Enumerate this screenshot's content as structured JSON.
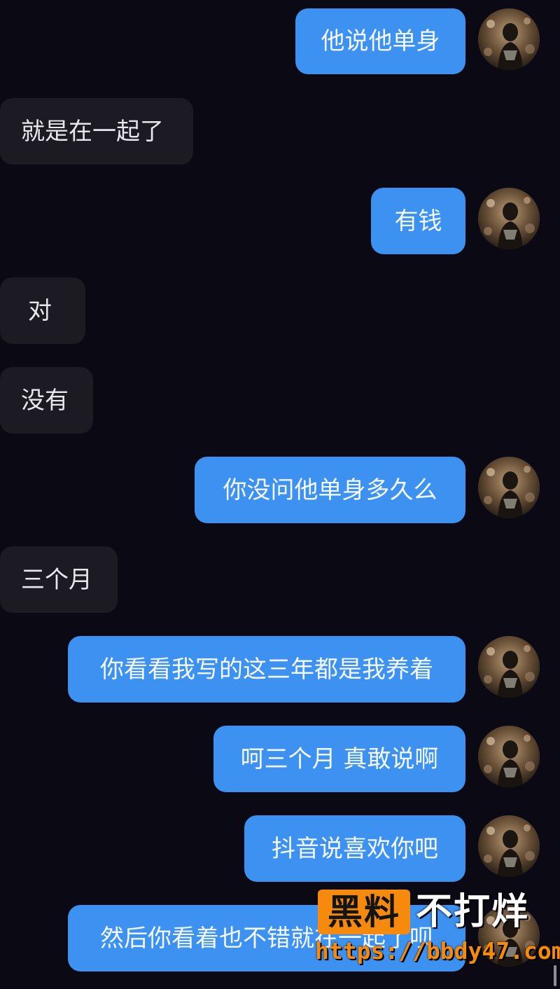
{
  "messages": [
    {
      "side": "sent",
      "text": "他说他单身"
    },
    {
      "side": "recv",
      "text": "就是在一起了"
    },
    {
      "side": "sent",
      "text": "有钱"
    },
    {
      "side": "recv",
      "text": "对"
    },
    {
      "side": "recv",
      "text": "没有"
    },
    {
      "side": "sent",
      "text": "你没问他单身多久么"
    },
    {
      "side": "recv",
      "text": "三个月"
    },
    {
      "side": "sent",
      "text": "你看看我写的这三年都是我养着"
    },
    {
      "side": "sent",
      "text": "呵三个月 真敢说啊"
    },
    {
      "side": "sent",
      "text": "抖音说喜欢你吧"
    },
    {
      "side": "sent",
      "text": "然后你看着也不错就在一起了呗"
    }
  ],
  "avatar": {
    "icon": "user-avatar-photo"
  },
  "watermark": {
    "box_text": "黑料",
    "text": "不打烊",
    "url": "https://bbdy47.com"
  },
  "colors": {
    "background": "#0b0a14",
    "sent_bubble": "#3d91f0",
    "received_bubble": "#1c1b24",
    "watermark_orange": "#f68a0c"
  }
}
